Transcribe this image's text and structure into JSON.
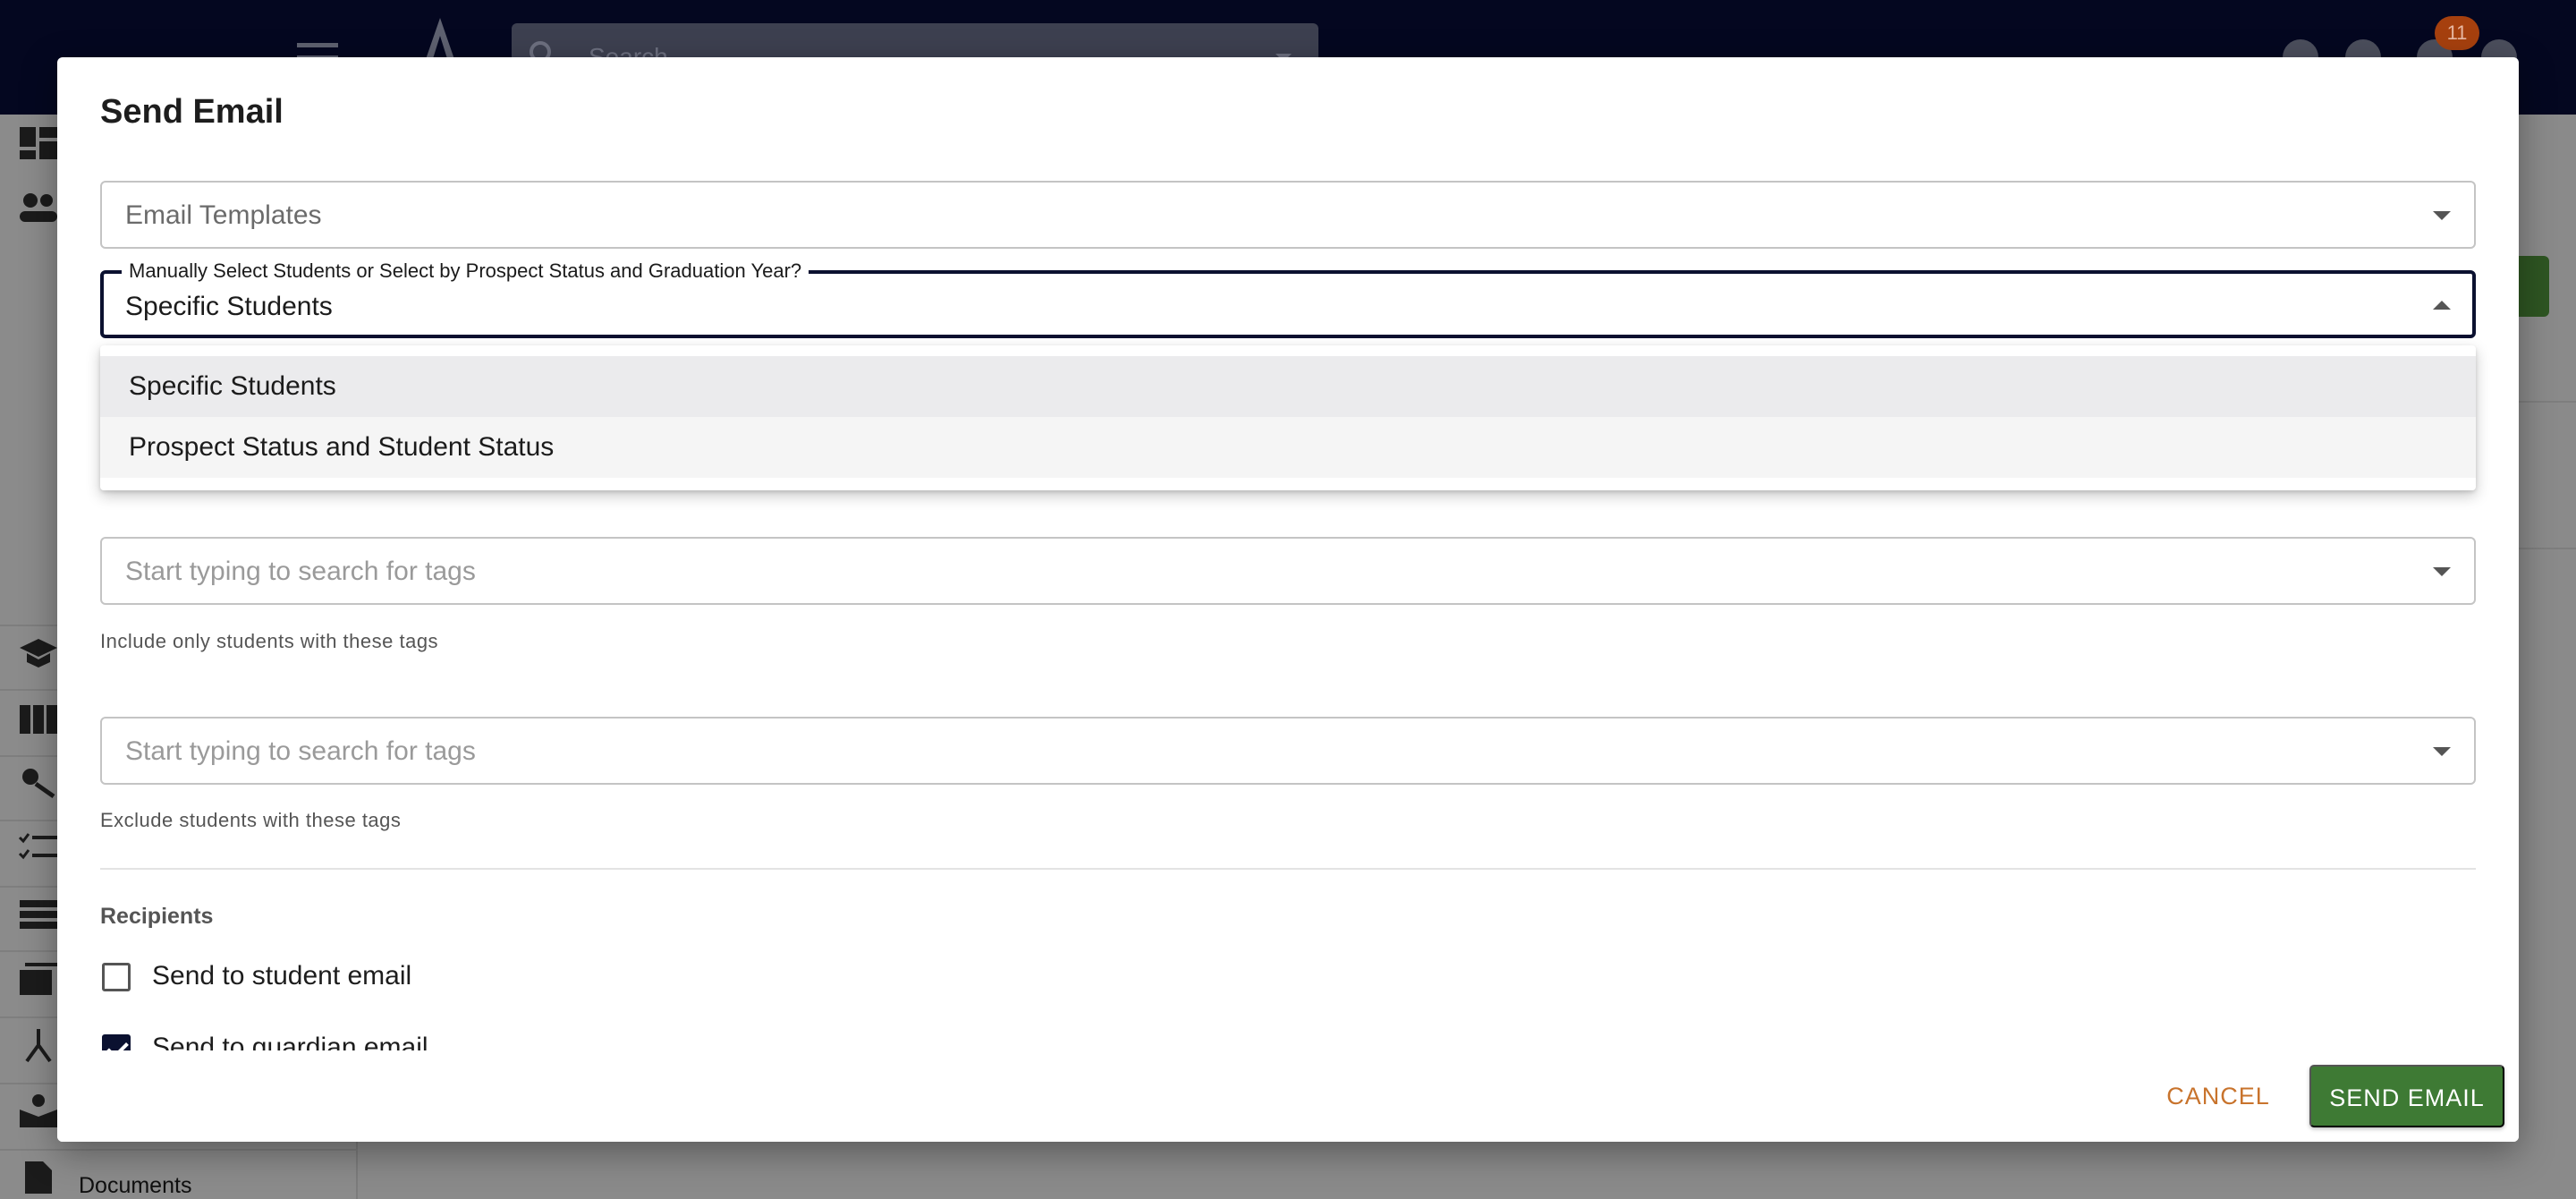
{
  "header": {
    "search_placeholder": "Search",
    "notification_count": "11"
  },
  "sidebar": {
    "documents_label": "Documents"
  },
  "dialog": {
    "title": "Send Email",
    "email_templates": {
      "placeholder": "Email Templates"
    },
    "selection_mode": {
      "label": "Manually Select Students or Select by Prospect Status and Graduation Year?",
      "value": "Specific Students",
      "options": [
        "Specific Students",
        "Prospect Status and Student Status"
      ]
    },
    "include_tags": {
      "placeholder": "Start typing to search for tags",
      "helper": "Include only students with these tags"
    },
    "exclude_tags": {
      "placeholder": "Start typing to search for tags",
      "helper": "Exclude students with these tags"
    },
    "recipients": {
      "label": "Recipients",
      "student_email": {
        "label": "Send to student email",
        "checked": false
      },
      "guardian_email": {
        "label": "Send to guardian email",
        "checked": true
      }
    },
    "actions": {
      "cancel_label": "CANCEL",
      "send_label": "SEND EMAIL"
    }
  },
  "colors": {
    "topbar": "#040720",
    "primary_dark": "#0b1130",
    "send_button": "#3e7a34",
    "cancel_text": "#c8732c",
    "badge": "#a6400e"
  }
}
